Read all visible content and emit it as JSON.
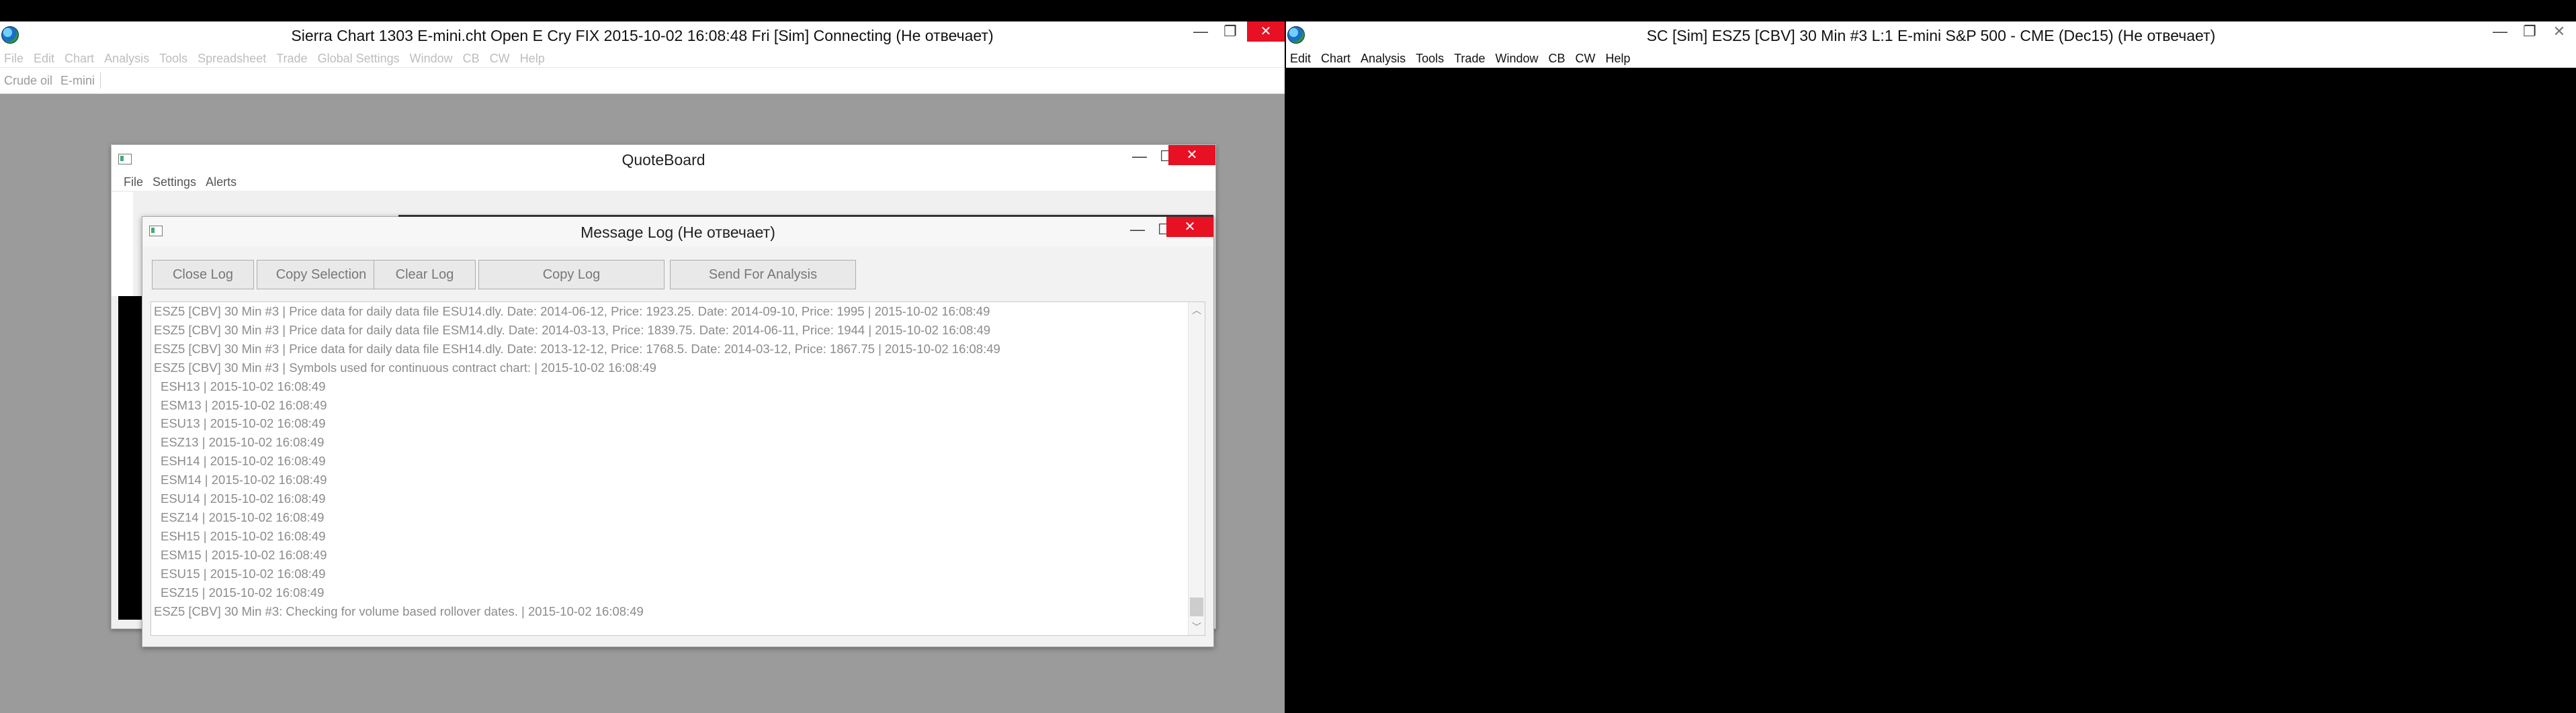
{
  "main_window": {
    "title": "Sierra Chart 1303 E-mini.cht  Open E Cry FIX 2015-10-02  16:08:48 Fri [Sim]  Connecting (Не отвечает)",
    "menu": [
      "File",
      "Edit",
      "Chart",
      "Analysis",
      "Tools",
      "Spreadsheet",
      "Trade",
      "Global Settings",
      "Window",
      "CB",
      "CW",
      "Help"
    ],
    "chartbook_tabs": [
      "Crude oil",
      "E-mini"
    ]
  },
  "quoteboard": {
    "title": "QuoteBoard",
    "menu": [
      "File",
      "Settings",
      "Alerts"
    ]
  },
  "message_log": {
    "title": "Message Log (Не отвечает)",
    "buttons": {
      "close_log": "Close Log",
      "copy_selection": "Copy Selection",
      "clear_log": "Clear Log",
      "copy_log": "Copy Log",
      "send_for_analysis": "Send For Analysis"
    },
    "lines": [
      "ESZ5 [CBV]  30 Min   #3 | Price data for daily data file ESU14.dly. Date: 2014-06-12, Price: 1923.25.  Date: 2014-09-10, Price: 1995 | 2015-10-02  16:08:49",
      "ESZ5 [CBV]  30 Min   #3 | Price data for daily data file ESM14.dly. Date: 2014-03-13, Price: 1839.75.  Date: 2014-06-11, Price: 1944 | 2015-10-02  16:08:49",
      "ESZ5 [CBV]  30 Min   #3 | Price data for daily data file ESH14.dly. Date: 2013-12-12, Price: 1768.5.  Date: 2014-03-12, Price: 1867.75 | 2015-10-02  16:08:49",
      "ESZ5 [CBV]  30 Min   #3 | Symbols used for continuous contract chart: | 2015-10-02  16:08:49",
      "ESH13 | 2015-10-02  16:08:49",
      "ESM13 | 2015-10-02  16:08:49",
      "ESU13 | 2015-10-02  16:08:49",
      "ESZ13 | 2015-10-02  16:08:49",
      "ESH14 | 2015-10-02  16:08:49",
      "ESM14 | 2015-10-02  16:08:49",
      "ESU14 | 2015-10-02  16:08:49",
      "ESZ14 | 2015-10-02  16:08:49",
      "ESH15 | 2015-10-02  16:08:49",
      "ESM15 | 2015-10-02  16:08:49",
      "ESU15 | 2015-10-02  16:08:49",
      "ESZ15 | 2015-10-02  16:08:49",
      "ESZ5 [CBV]  30 Min   #3: Checking for volume based rollover dates. | 2015-10-02  16:08:49"
    ]
  },
  "chart_window": {
    "title": "SC [Sim] ESZ5 [CBV]  30 Min   #3  L:1  E-mini S&P 500 - CME (Dec15) (Не отвечает)",
    "menu": [
      "Edit",
      "Chart",
      "Analysis",
      "Tools",
      "Trade",
      "Window",
      "CB",
      "CW",
      "Help"
    ]
  },
  "glyphs": {
    "minimize": "—",
    "maximize": "☐",
    "restore": "❐",
    "close": "✕",
    "scroll_up": "︿",
    "scroll_down": "﹀",
    "scroll_left": "‹",
    "scroll_right": "›"
  }
}
